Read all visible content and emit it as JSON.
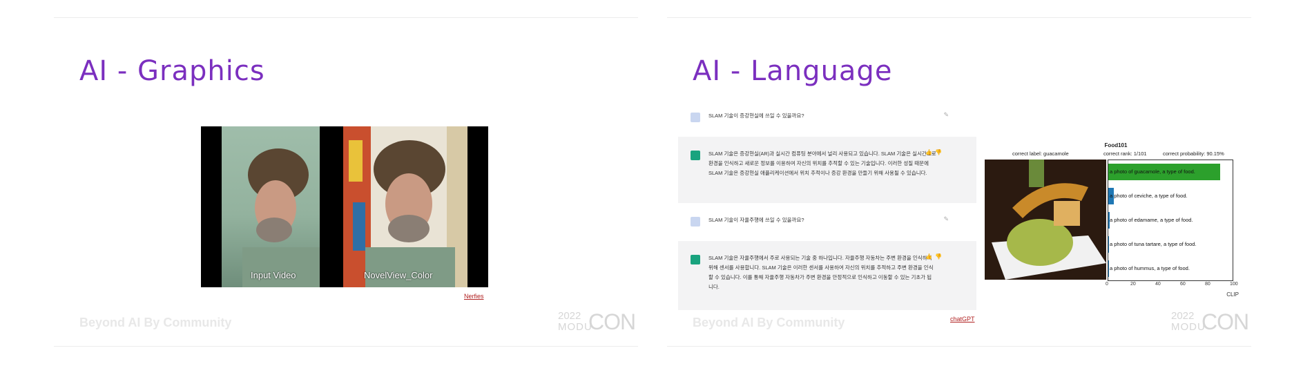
{
  "left": {
    "title": "AI - Graphics",
    "footer": "Beyond AI By Community",
    "logo": {
      "year": "2022",
      "mod": "MODU",
      "con": "CON"
    },
    "video": {
      "label_left": "Input Video",
      "label_right": "NovelView_Color"
    },
    "credit": "Nerfies"
  },
  "right": {
    "title": "AI - Language",
    "footer": "Beyond AI By Community",
    "logo": {
      "year": "2022",
      "mod": "MODU",
      "con": "CON"
    },
    "credit": "chatGPT",
    "chat": [
      {
        "role": "user",
        "text": "SLAM 기술이 증강현실에 쓰일 수 있을까요?"
      },
      {
        "role": "bot",
        "text": "SLAM 기술은 증강현실(AR)과 실시간 컴퓨팅 분야에서 널리 사용되고 있습니다. SLAM 기술은 실시간으로 환경을 인식하고 새로운 정보를 이용하여 자신의 위치를 추적할 수 있는 기술입니다. 이러한 성질 때문에 SLAM 기술은 증강현실 애플리케이션에서 위치 추적이나 증강 환경을 만들기 위해 사용될 수 있습니다."
      },
      {
        "role": "user",
        "text": "SLAM 기술이 자율주행에 쓰일 수 있을까요?"
      },
      {
        "role": "bot",
        "text": "SLAM 기술은 자율주행에서 주로 사용되는 기술 중 하나입니다. 자율주행 자동차는 주변 환경을 인식하기 위해 센서를 사용합니다. SLAM 기술은 이러한 센서를 사용하여 자신의 위치를 추적하고 주변 환경을 인식할 수 있습니다. 이를 통해 자율주행 자동차가 주변 환경을 안정적으로 인식하고 이동할 수 있는 기초가 됩니다."
      }
    ]
  },
  "chart_data": {
    "type": "bar",
    "title": "Food101",
    "info": {
      "label": "correct label: guacamole",
      "rank": "correct rank: 1/101",
      "prob": "correct probability: 90.15%"
    },
    "categories": [
      "a photo of guacamole, a type of food.",
      "a photo of ceviche, a type of food.",
      "a photo of edamame, a type of food.",
      "a photo of tuna tartare, a type of food.",
      "a photo of hummus, a type of food."
    ],
    "values": [
      90.15,
      4.5,
      1.2,
      0.7,
      0.4
    ],
    "bar_colors": [
      "#2ca02c",
      "#1f77b4",
      "#1f77b4",
      "#1f77b4",
      "#1f77b4"
    ],
    "xticks": [
      "0",
      "20",
      "40",
      "60",
      "80",
      "100"
    ],
    "xlim": [
      0,
      100
    ],
    "xlabel": "CLIP"
  }
}
